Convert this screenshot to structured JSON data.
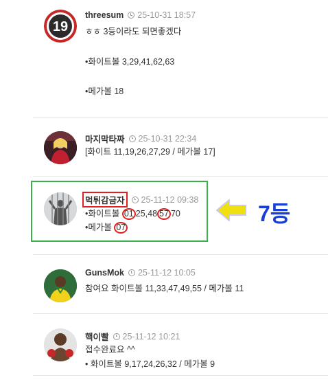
{
  "comments": [
    {
      "nickname": "threesum",
      "date": "25-10-31 18:57",
      "lines": [
        "ㅎㅎ 3등이라도 되면좋겠다",
        "•화이트볼 3,29,41,62,63",
        "•메가볼 18"
      ],
      "avatar_text": "19"
    },
    {
      "nickname": "마지막타짜",
      "date": "25-10-31 22:34",
      "lines": [
        "[화이트 11,19,26,27,29 / 메가볼 17]"
      ]
    },
    {
      "nickname": "먹튀감금자",
      "date": "25-11-12 09:38",
      "white_prefix": "•화이트볼 ",
      "white_n1": "01",
      "white_mid": "25,48",
      "white_n2": "57",
      "white_end": "70",
      "mega_prefix": "•메가볼 ",
      "mega_n1": "07"
    },
    {
      "nickname": "GunsMok",
      "date": "25-11-12 10:05",
      "lines": [
        "참여요 화이트볼 11,33,47,49,55 / 메가볼 11"
      ]
    },
    {
      "nickname": "핵이빨",
      "date": "25-11-12 10:21",
      "lines": [
        "접수완료요 ^^",
        "• 화이트볼 9,17,24,26,32 / 메가볼 9"
      ]
    }
  ],
  "annotation": {
    "rank_label": "7등",
    "arrow_color": "#f0e010",
    "box_color": "#3cb04b",
    "circle_color": "#e02020",
    "rank_color": "#1a3fd6"
  }
}
